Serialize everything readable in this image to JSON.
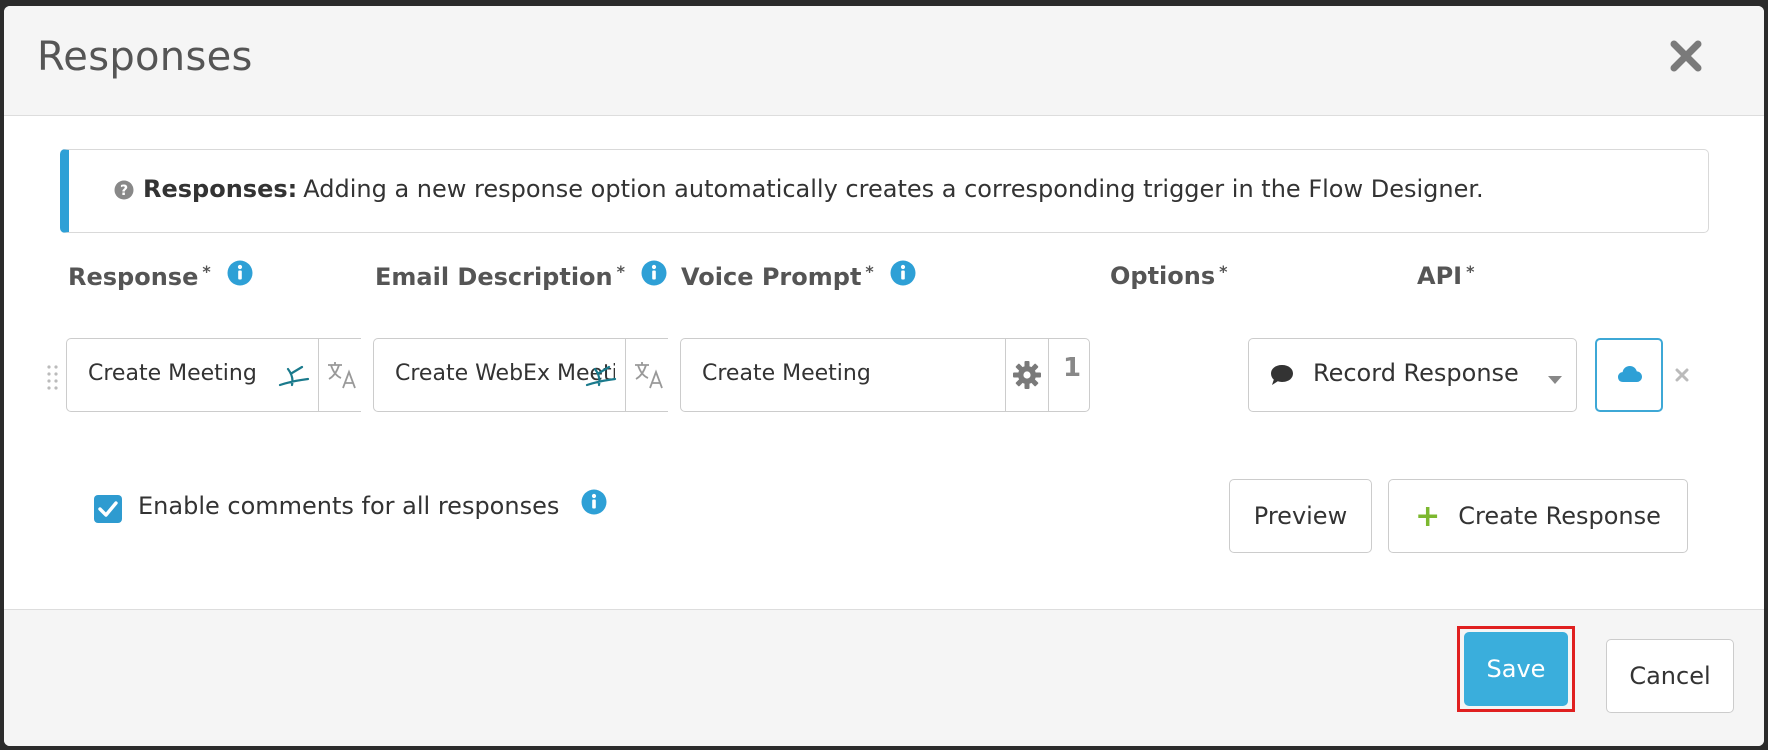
{
  "modal": {
    "title": "Responses",
    "close_icon": "close-icon"
  },
  "alert": {
    "icon": "question-circle-icon",
    "bold": "Responses:",
    "text": "Adding a new response option automatically creates a corresponding trigger in the Flow Designer."
  },
  "columns": {
    "response": "Response",
    "email_description": "Email Description",
    "voice_prompt": "Voice Prompt",
    "options": "Options",
    "api": "API",
    "required_mark": "*"
  },
  "row": {
    "response_value": "Create Meeting",
    "email_value": "Create WebEx Meetir",
    "voice_value": "Create Meeting",
    "voice_count": "1",
    "option_value": "Record Response"
  },
  "comments": {
    "checked": true,
    "label": "Enable comments for all responses"
  },
  "buttons": {
    "preview": "Preview",
    "create_plus": "+",
    "create_response": "Create Response",
    "save": "Save",
    "cancel": "Cancel"
  },
  "colors": {
    "accent": "#2ea0d6",
    "save": "#3aaedc",
    "highlight": "#e02020",
    "plus": "#7cb82f"
  }
}
